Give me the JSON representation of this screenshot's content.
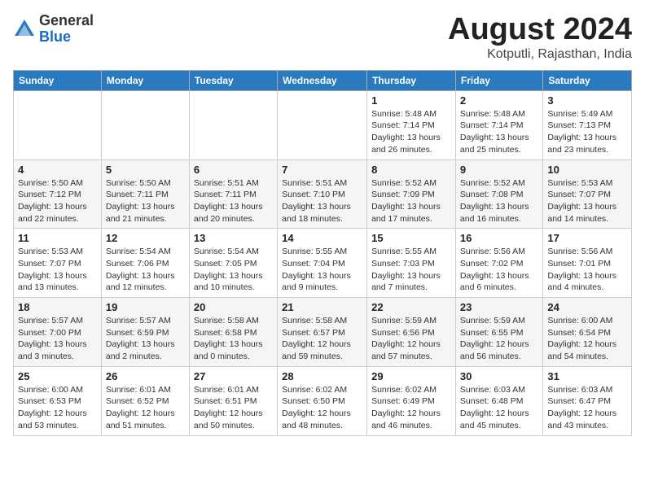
{
  "logo": {
    "general": "General",
    "blue": "Blue"
  },
  "title": "August 2024",
  "location": "Kotputli, Rajasthan, India",
  "days_of_week": [
    "Sunday",
    "Monday",
    "Tuesday",
    "Wednesday",
    "Thursday",
    "Friday",
    "Saturday"
  ],
  "weeks": [
    [
      {
        "day": "",
        "info": ""
      },
      {
        "day": "",
        "info": ""
      },
      {
        "day": "",
        "info": ""
      },
      {
        "day": "",
        "info": ""
      },
      {
        "day": "1",
        "info": "Sunrise: 5:48 AM\nSunset: 7:14 PM\nDaylight: 13 hours\nand 26 minutes."
      },
      {
        "day": "2",
        "info": "Sunrise: 5:48 AM\nSunset: 7:14 PM\nDaylight: 13 hours\nand 25 minutes."
      },
      {
        "day": "3",
        "info": "Sunrise: 5:49 AM\nSunset: 7:13 PM\nDaylight: 13 hours\nand 23 minutes."
      }
    ],
    [
      {
        "day": "4",
        "info": "Sunrise: 5:50 AM\nSunset: 7:12 PM\nDaylight: 13 hours\nand 22 minutes."
      },
      {
        "day": "5",
        "info": "Sunrise: 5:50 AM\nSunset: 7:11 PM\nDaylight: 13 hours\nand 21 minutes."
      },
      {
        "day": "6",
        "info": "Sunrise: 5:51 AM\nSunset: 7:11 PM\nDaylight: 13 hours\nand 20 minutes."
      },
      {
        "day": "7",
        "info": "Sunrise: 5:51 AM\nSunset: 7:10 PM\nDaylight: 13 hours\nand 18 minutes."
      },
      {
        "day": "8",
        "info": "Sunrise: 5:52 AM\nSunset: 7:09 PM\nDaylight: 13 hours\nand 17 minutes."
      },
      {
        "day": "9",
        "info": "Sunrise: 5:52 AM\nSunset: 7:08 PM\nDaylight: 13 hours\nand 16 minutes."
      },
      {
        "day": "10",
        "info": "Sunrise: 5:53 AM\nSunset: 7:07 PM\nDaylight: 13 hours\nand 14 minutes."
      }
    ],
    [
      {
        "day": "11",
        "info": "Sunrise: 5:53 AM\nSunset: 7:07 PM\nDaylight: 13 hours\nand 13 minutes."
      },
      {
        "day": "12",
        "info": "Sunrise: 5:54 AM\nSunset: 7:06 PM\nDaylight: 13 hours\nand 12 minutes."
      },
      {
        "day": "13",
        "info": "Sunrise: 5:54 AM\nSunset: 7:05 PM\nDaylight: 13 hours\nand 10 minutes."
      },
      {
        "day": "14",
        "info": "Sunrise: 5:55 AM\nSunset: 7:04 PM\nDaylight: 13 hours\nand 9 minutes."
      },
      {
        "day": "15",
        "info": "Sunrise: 5:55 AM\nSunset: 7:03 PM\nDaylight: 13 hours\nand 7 minutes."
      },
      {
        "day": "16",
        "info": "Sunrise: 5:56 AM\nSunset: 7:02 PM\nDaylight: 13 hours\nand 6 minutes."
      },
      {
        "day": "17",
        "info": "Sunrise: 5:56 AM\nSunset: 7:01 PM\nDaylight: 13 hours\nand 4 minutes."
      }
    ],
    [
      {
        "day": "18",
        "info": "Sunrise: 5:57 AM\nSunset: 7:00 PM\nDaylight: 13 hours\nand 3 minutes."
      },
      {
        "day": "19",
        "info": "Sunrise: 5:57 AM\nSunset: 6:59 PM\nDaylight: 13 hours\nand 2 minutes."
      },
      {
        "day": "20",
        "info": "Sunrise: 5:58 AM\nSunset: 6:58 PM\nDaylight: 13 hours\nand 0 minutes."
      },
      {
        "day": "21",
        "info": "Sunrise: 5:58 AM\nSunset: 6:57 PM\nDaylight: 12 hours\nand 59 minutes."
      },
      {
        "day": "22",
        "info": "Sunrise: 5:59 AM\nSunset: 6:56 PM\nDaylight: 12 hours\nand 57 minutes."
      },
      {
        "day": "23",
        "info": "Sunrise: 5:59 AM\nSunset: 6:55 PM\nDaylight: 12 hours\nand 56 minutes."
      },
      {
        "day": "24",
        "info": "Sunrise: 6:00 AM\nSunset: 6:54 PM\nDaylight: 12 hours\nand 54 minutes."
      }
    ],
    [
      {
        "day": "25",
        "info": "Sunrise: 6:00 AM\nSunset: 6:53 PM\nDaylight: 12 hours\nand 53 minutes."
      },
      {
        "day": "26",
        "info": "Sunrise: 6:01 AM\nSunset: 6:52 PM\nDaylight: 12 hours\nand 51 minutes."
      },
      {
        "day": "27",
        "info": "Sunrise: 6:01 AM\nSunset: 6:51 PM\nDaylight: 12 hours\nand 50 minutes."
      },
      {
        "day": "28",
        "info": "Sunrise: 6:02 AM\nSunset: 6:50 PM\nDaylight: 12 hours\nand 48 minutes."
      },
      {
        "day": "29",
        "info": "Sunrise: 6:02 AM\nSunset: 6:49 PM\nDaylight: 12 hours\nand 46 minutes."
      },
      {
        "day": "30",
        "info": "Sunrise: 6:03 AM\nSunset: 6:48 PM\nDaylight: 12 hours\nand 45 minutes."
      },
      {
        "day": "31",
        "info": "Sunrise: 6:03 AM\nSunset: 6:47 PM\nDaylight: 12 hours\nand 43 minutes."
      }
    ]
  ]
}
